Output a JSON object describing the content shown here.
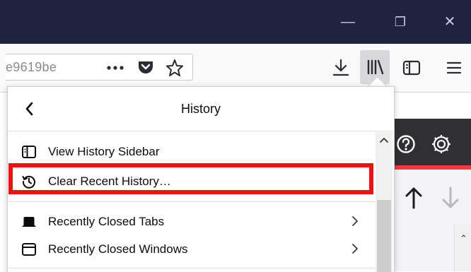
{
  "window": {
    "minimize_glyph": "—",
    "restore_glyph": "❐",
    "close_glyph": "✕"
  },
  "urlbar": {
    "text": "e9619be"
  },
  "panel": {
    "title": "History",
    "items": [
      {
        "label": "View History Sidebar",
        "icon": "sidebar-icon"
      },
      {
        "label": "Clear Recent History…",
        "icon": "history-clock-icon"
      },
      {
        "label": "Recently Closed Tabs",
        "icon": "tab-icon"
      },
      {
        "label": "Recently Closed Windows",
        "icon": "window-icon"
      }
    ]
  },
  "colors": {
    "titlebar": "#202340",
    "highlight": "#ee1111",
    "page_red": "#ee3b3b"
  }
}
